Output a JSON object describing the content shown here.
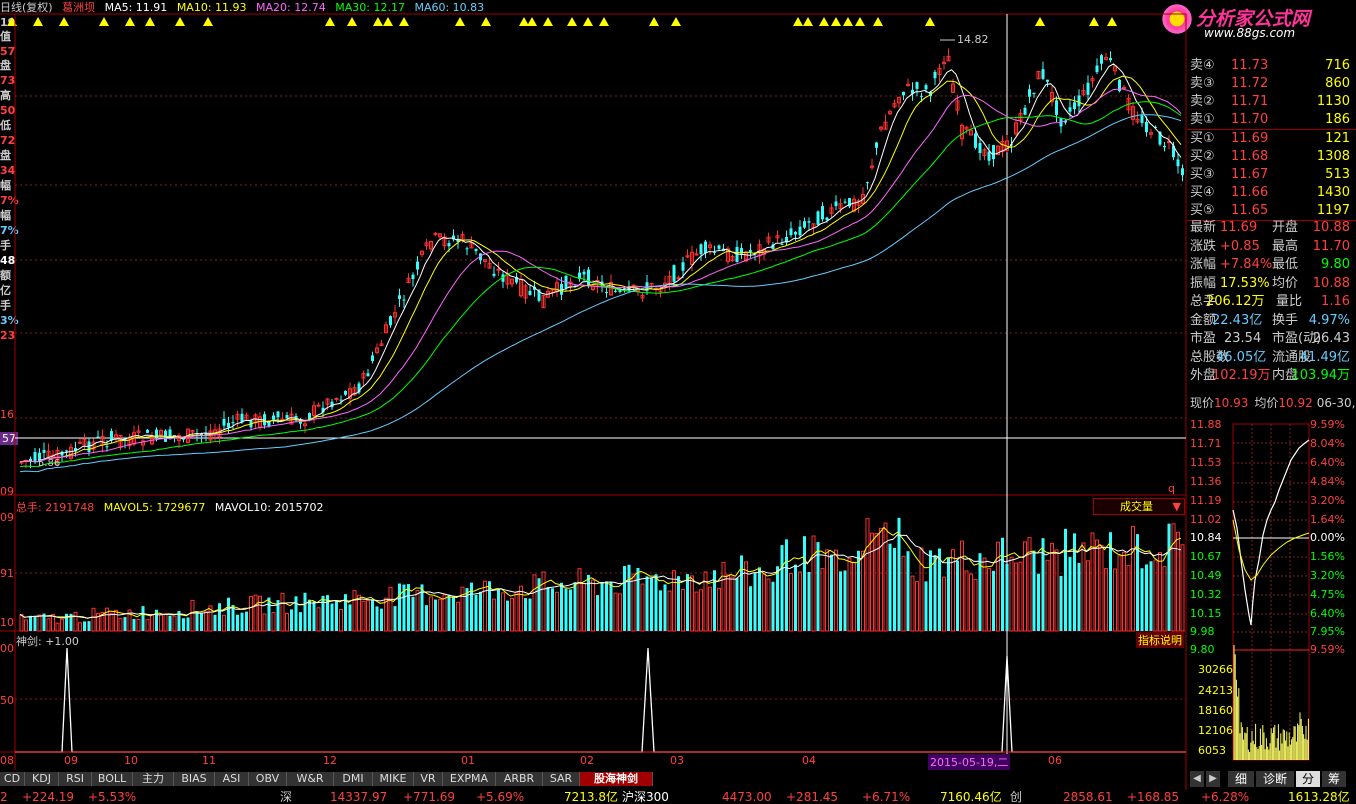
{
  "header": {
    "period": "日线(复权)",
    "stock": "葛洲坝",
    "ma5": "MA5: 11.91",
    "ma10": "MA10: 11.93",
    "ma20": "MA20: 12.74",
    "ma30": "MA30: 12.17",
    "ma60": "MA60: 10.83"
  },
  "logo": {
    "cn": "分析家公式网",
    "url": "www.88gs.com"
  },
  "left_labels": [
    "19",
    "值",
    "57",
    "盘",
    "73",
    "高",
    "50",
    "低",
    "72",
    "盘",
    "34",
    "幅",
    "7%",
    "幅",
    "7%",
    "手",
    "48",
    "额",
    "亿",
    "手",
    "3%",
    "23"
  ],
  "price_axis": {
    "mid1": "16",
    "mid2": "57",
    "bottom": "09"
  },
  "annotations": {
    "high": "14.82",
    "low": "5.86",
    "crosshair_date": "2015-05-19,二"
  },
  "volume": {
    "label": "总手: 2191748",
    "mavol5": "MAVOL5: 1729677",
    "mavol10": "MAVOL10: 2015702",
    "dropdown": "成交量",
    "axis": [
      "09",
      "91",
      "10"
    ]
  },
  "indicator": {
    "label": "神剑: +1.00",
    "help": "指标说明",
    "axis": [
      "00",
      "50",
      "08"
    ]
  },
  "x_dates": [
    "09",
    "10",
    "11",
    "12",
    "01",
    "02",
    "03",
    "04",
    "06"
  ],
  "orderbook": {
    "sell": [
      {
        "k": "卖④",
        "p": "11.73",
        "v": "716"
      },
      {
        "k": "卖③",
        "p": "11.72",
        "v": "860"
      },
      {
        "k": "卖②",
        "p": "11.71",
        "v": "1130"
      },
      {
        "k": "卖①",
        "p": "11.70",
        "v": "186"
      }
    ],
    "buy": [
      {
        "k": "买①",
        "p": "11.69",
        "v": "121"
      },
      {
        "k": "买②",
        "p": "11.68",
        "v": "1308"
      },
      {
        "k": "买③",
        "p": "11.67",
        "v": "513"
      },
      {
        "k": "买④",
        "p": "11.66",
        "v": "1430"
      },
      {
        "k": "买⑤",
        "p": "11.65",
        "v": "1197"
      }
    ]
  },
  "quote": [
    {
      "a": "最新",
      "av": "11.69",
      "b": "开盘",
      "bv": "10.88"
    },
    {
      "a": "涨跌",
      "av": "+0.85",
      "b": "最高",
      "bv": "11.70"
    },
    {
      "a": "涨幅",
      "av": "+7.84%",
      "b": "最低",
      "bv": "9.80"
    },
    {
      "a": "振幅",
      "av": "17.53%",
      "b": "均价",
      "bv": "10.88"
    },
    {
      "a": "总手",
      "av": "206.12万",
      "b": "量比",
      "bv": "1.16"
    },
    {
      "a": "金额",
      "av": "22.43亿",
      "b": "换手",
      "bv": "4.97%"
    },
    {
      "a": "市盈",
      "av": "23.54",
      "b": "市盈(动)",
      "bv": "26.43"
    },
    {
      "a": "总股数",
      "av": "46.05亿",
      "b": "流通股",
      "bv": "41.49亿"
    },
    {
      "a": "外盘",
      "av": "102.19万",
      "b": "内盘",
      "bv": "103.94万"
    }
  ],
  "intraday": {
    "now_label": "现价",
    "now_val": "10.93",
    "avg_label": "均价",
    "avg_val": "10.92",
    "date": "06-30,二",
    "left_axis": [
      "11.88",
      "11.71",
      "11.53",
      "11.36",
      "11.19",
      "11.02",
      "10.84",
      "10.67",
      "10.49",
      "10.32",
      "10.15",
      "9.98",
      "9.80"
    ],
    "right_axis": [
      "9.59%",
      "8.04%",
      "6.40%",
      "4.84%",
      "3.20%",
      "1.64%",
      "0.00%",
      "1.56%",
      "3.20%",
      "4.75%",
      "6.40%",
      "7.95%",
      "9.59%"
    ],
    "vol_axis": [
      "30266",
      "24213",
      "18160",
      "12106",
      "6053"
    ]
  },
  "tabs": [
    "CD",
    "KDJ",
    "RSI",
    "BOLL",
    "主力",
    "BIAS",
    "ASI",
    "OBV",
    "W&R",
    "DMI",
    "MIKE",
    "VR",
    "EXPMA",
    "ARBR",
    "SAR",
    "股海神剑"
  ],
  "right_tabs": [
    "细",
    "诊断",
    "分",
    "筹"
  ],
  "status": [
    {
      "t": "2",
      "c": "#ff4040"
    },
    {
      "t": "+224.19",
      "c": "#ff4040"
    },
    {
      "t": "+5.53%",
      "c": "#ff4040"
    },
    {
      "t": "深",
      "c": "#cccccc"
    },
    {
      "t": "14337.97",
      "c": "#ff4040"
    },
    {
      "t": "+771.69",
      "c": "#ff4040"
    },
    {
      "t": "+5.69%",
      "c": "#ff4040"
    },
    {
      "t": "7213.8亿",
      "c": "#ffff00"
    },
    {
      "t": "沪深300",
      "c": "#ffffff"
    },
    {
      "t": "4473.00",
      "c": "#ff4040"
    },
    {
      "t": "+281.45",
      "c": "#ff4040"
    },
    {
      "t": "+6.71%",
      "c": "#ff4040"
    },
    {
      "t": "7160.46亿",
      "c": "#ffff00"
    },
    {
      "t": "创",
      "c": "#cccccc"
    },
    {
      "t": "2858.61",
      "c": "#ff4040"
    },
    {
      "t": "+168.85",
      "c": "#ff4040"
    },
    {
      "t": "+6.28%",
      "c": "#ff4040"
    },
    {
      "t": "1613.28亿",
      "c": "#ffff00"
    }
  ]
}
